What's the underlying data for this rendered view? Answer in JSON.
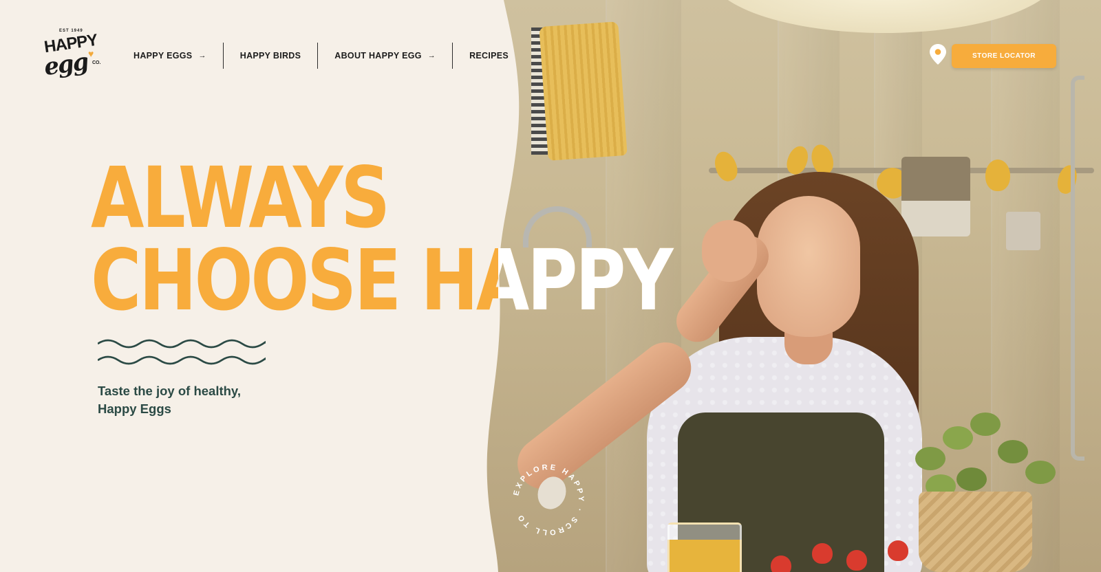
{
  "brand": {
    "logo_est": "EST 1949",
    "logo_word_1": "HAPPY",
    "logo_word_2": "egg",
    "logo_co": "CO."
  },
  "nav": {
    "items": [
      {
        "label": "HAPPY EGGS",
        "arrow": "→"
      },
      {
        "label": "HAPPY BIRDS",
        "arrow": ""
      },
      {
        "label": "ABOUT HAPPY EGG",
        "arrow": "→"
      },
      {
        "label": "RECIPES",
        "arrow": ""
      }
    ]
  },
  "header": {
    "store_locator_label": "STORE LOCATOR",
    "pin_icon": "map-pin-icon"
  },
  "hero": {
    "headline_line_1": "ALWAYS",
    "headline_line_2": "CHOOSE HAPPY",
    "tagline": "Taste the joy of healthy, Happy Eggs",
    "scroll_badge_text": "EXPLORE HAPPY · SCROLL TO"
  },
  "colors": {
    "cream": "#f6f0e8",
    "accent": "#f8ac3c",
    "tagline": "#2b4a45",
    "ink": "#1c1c1c"
  }
}
